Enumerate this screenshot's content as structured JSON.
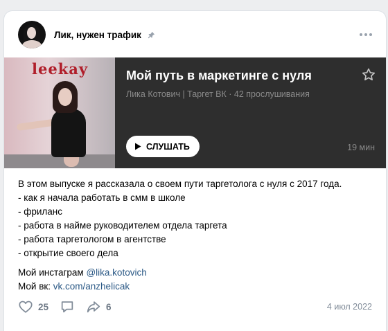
{
  "post": {
    "author": "Лик, нужен трафик",
    "date": "4 июл 2022"
  },
  "podcast": {
    "cover_logo": "leekay",
    "title": "Мой путь в маркетинге с нуля",
    "meta": "Лика Котович | Таргет ВК · 42 прослушивания",
    "listen_label": "СЛУШАТЬ",
    "duration": "19 мин"
  },
  "text_lines": [
    "В этом выпуске я рассказала о своем пути таргетолога с нуля с 2017 года.",
    "- как я начала работать в смм в школе",
    "- фриланс",
    "- работа в найме руководителем отдела таргета",
    "- работа таргетологом в агентстве",
    "- открытие своего дела"
  ],
  "links": {
    "instagram_label": "Мой инстаграм ",
    "instagram_link": "@lika.kotovich",
    "vk_label": "Мой вк: ",
    "vk_link": "vk.com/anzhelicak"
  },
  "actions": {
    "likes": "25",
    "shares": "6"
  },
  "icons": [
    "pin-icon",
    "more-icon",
    "star-icon",
    "play-icon",
    "like-icon",
    "comment-icon",
    "share-icon"
  ],
  "colors": {
    "link": "#2a5885",
    "podcast_bg": "#2e2e2e",
    "icon_grey": "#6d7885"
  }
}
